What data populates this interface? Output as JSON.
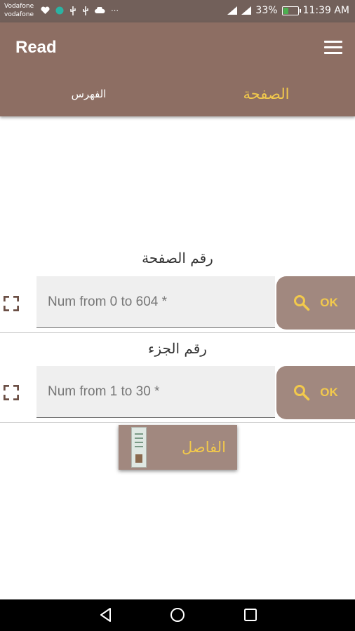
{
  "status_bar": {
    "carrier_1": "Vodafone",
    "carrier_2": "vodafone",
    "signal_1_type": "3G",
    "signal_2_type": "3G",
    "battery_percent": "33%",
    "battery_level": 0.33,
    "time": "11:39 AM",
    "icons": [
      "heart-icon",
      "app-circle-icon",
      "usb-icon",
      "usb-icon",
      "cloud-icon",
      "more-icon"
    ]
  },
  "app_bar": {
    "title": "Read",
    "menu_icon": "hamburger-menu-icon",
    "tabs": [
      {
        "label": "الفهرس",
        "selected": false
      },
      {
        "label": "الصفحة",
        "selected": true
      }
    ]
  },
  "page_section": {
    "label": "رقم الصفحة",
    "placeholder": "Num from 0 to 604 *",
    "ok_label": "OK",
    "expand_icon": "expand-icon",
    "search_icon": "search-icon"
  },
  "part_section": {
    "label": "رقم الجزء",
    "placeholder": "Num from 1 to 30 *",
    "ok_label": "OK",
    "expand_icon": "expand-icon",
    "search_icon": "search-icon"
  },
  "bookmark": {
    "label": "الفاصل",
    "thumbnail_icon": "bookmark-thumbnail"
  },
  "nav_bar": {
    "icons": [
      "back-icon",
      "home-icon",
      "recents-icon"
    ]
  },
  "colors": {
    "status_bar": "#72605a",
    "app_bar": "#8d6e63",
    "button": "#a1887f",
    "accent": "#f2c94c"
  }
}
